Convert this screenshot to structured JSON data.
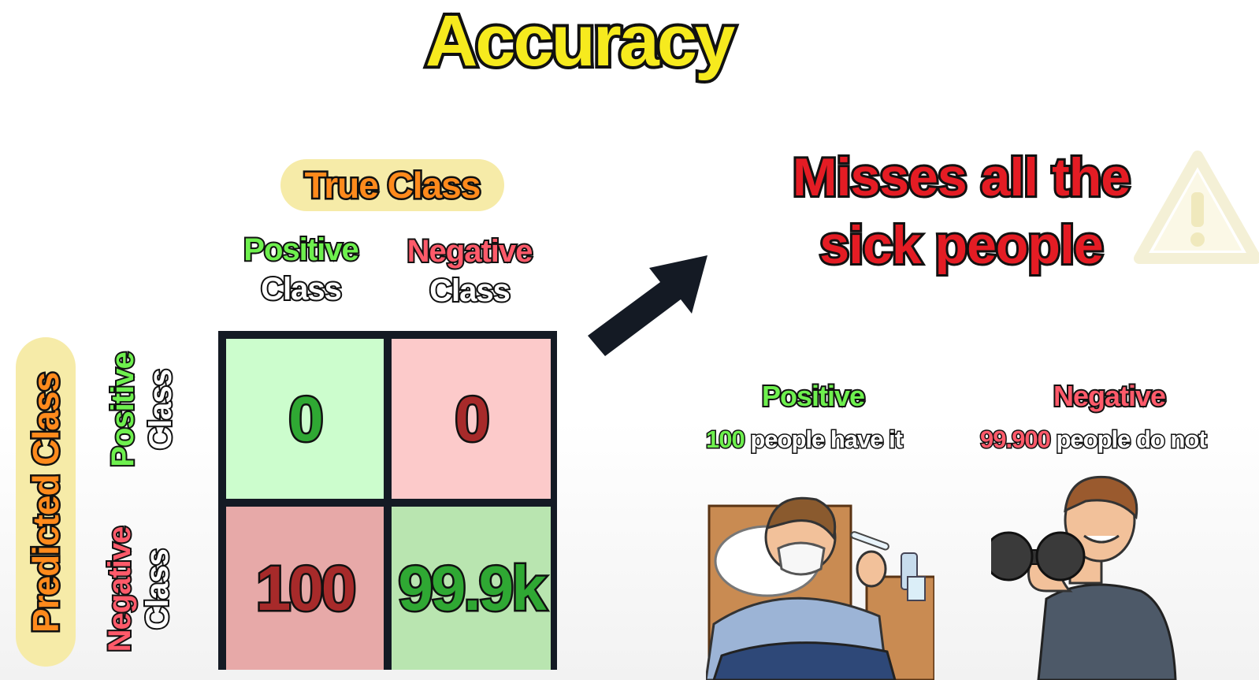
{
  "title": "Accuracy",
  "true_class_label": "True Class",
  "predicted_class_label": "Predicted Class",
  "columns": {
    "positive": {
      "word": "Positive",
      "class": "Class"
    },
    "negative": {
      "word": "Negative",
      "class": "Class"
    }
  },
  "rows": {
    "positive": {
      "word": "Positive",
      "class": "Class"
    },
    "negative": {
      "word": "Negative",
      "class": "Class"
    }
  },
  "matrix": {
    "true_positive": "0",
    "false_positive": "0",
    "false_negative": "100",
    "true_negative": "99.9k"
  },
  "headline": {
    "line1": "Misses all the",
    "line2": "sick people"
  },
  "stats": {
    "positive": {
      "heading": "Positive",
      "count": "100",
      "text": "people have it"
    },
    "negative": {
      "heading": "Negative",
      "count": "99.900",
      "text": "people do not"
    }
  },
  "colors": {
    "title": "#f6ea1e",
    "pill": "#f6eba8",
    "pill_text": "#ff8a1c",
    "positive_green": "#6ef04e",
    "negative_red": "#ff5a6a",
    "headline_red": "#e41c24",
    "arrow": "#141a24"
  },
  "icons": [
    "arrow-up-right-icon",
    "warning-icon",
    "sick-person-illustration",
    "healthy-person-illustration"
  ]
}
